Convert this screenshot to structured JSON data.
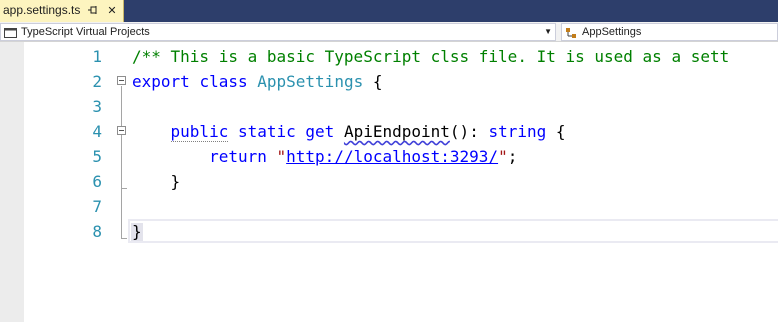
{
  "tab": {
    "title": "app.settings.ts",
    "pin_icon": "pin-icon",
    "close_icon": "close-icon"
  },
  "navbar": {
    "project": "TypeScript Virtual Projects",
    "member": "AppSettings"
  },
  "editor": {
    "lines": [
      {
        "number": "1",
        "text": "/** This is a basic TypeScript clss file. It is used as a sett"
      },
      {
        "number": "2",
        "text": "export class AppSettings {"
      },
      {
        "number": "3",
        "text": ""
      },
      {
        "number": "4",
        "text": "    public static get ApiEndpoint(): string {"
      },
      {
        "number": "5",
        "text": "        return \"http://localhost:3293/\";"
      },
      {
        "number": "6",
        "text": "    }"
      },
      {
        "number": "7",
        "text": ""
      },
      {
        "number": "8",
        "text": "}"
      }
    ]
  },
  "colors": {
    "tab_strip": "#2d3e6b",
    "active_tab": "#fdf4bf",
    "keyword": "#0000ff",
    "type": "#2b91af",
    "comment": "#008000",
    "string": "#a31515",
    "line_number": "#2b91af"
  }
}
